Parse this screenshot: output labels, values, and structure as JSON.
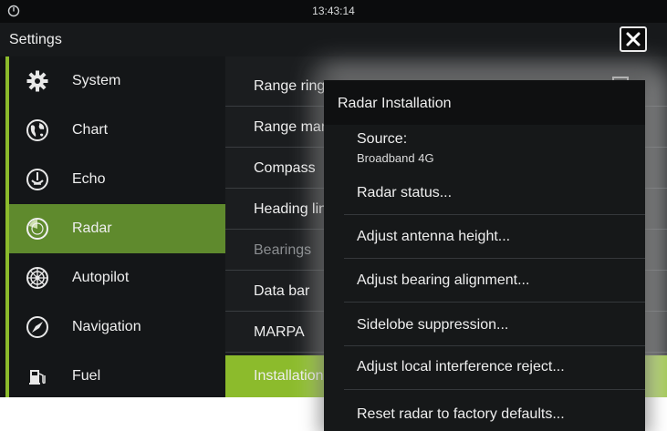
{
  "status_bar": {
    "time": "13:43:14"
  },
  "header": {
    "title": "Settings"
  },
  "sidebar": {
    "items": [
      {
        "label": "System",
        "icon": "gear-icon"
      },
      {
        "label": "Chart",
        "icon": "globe-icon"
      },
      {
        "label": "Echo",
        "icon": "echo-icon"
      },
      {
        "label": "Radar",
        "icon": "radar-icon",
        "active": true
      },
      {
        "label": "Autopilot",
        "icon": "helm-icon"
      },
      {
        "label": "Navigation",
        "icon": "compass-icon"
      },
      {
        "label": "Fuel",
        "icon": "fuel-pump-icon"
      }
    ]
  },
  "options": {
    "items": [
      {
        "label": "Range rings",
        "has_checkbox": true
      },
      {
        "label": "Range markers"
      },
      {
        "label": "Compass"
      },
      {
        "label": "Heading line"
      },
      {
        "label": "Bearings",
        "disabled": true
      },
      {
        "label": "Data bar"
      },
      {
        "label": "MARPA"
      },
      {
        "label": "Installation",
        "active": true
      }
    ]
  },
  "dialog": {
    "title": "Radar Installation",
    "source_label": "Source:",
    "source_value": "Broadband 4G",
    "items": [
      "Radar status...",
      "Adjust antenna height...",
      "Adjust bearing alignment...",
      "Sidelobe suppression...",
      "Adjust local interference reject...",
      "Reset radar to factory defaults..."
    ]
  },
  "colors": {
    "accent_green": "#8cbb2c",
    "active_sidebar": "#5f8a2d",
    "background": "#111214"
  }
}
